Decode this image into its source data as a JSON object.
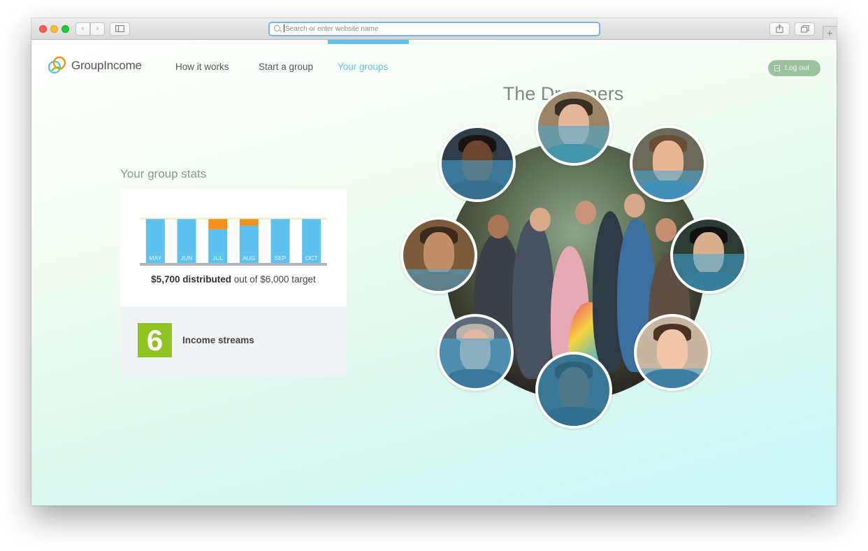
{
  "browser": {
    "address_placeholder": "Search or enter website name",
    "back_label": "‹",
    "forward_label": "›",
    "new_tab_label": "+"
  },
  "nav": {
    "logo_text": "GroupIncome",
    "items": [
      {
        "label": "How it works"
      },
      {
        "label": "Start a group"
      },
      {
        "label": "Your groups",
        "active": true
      }
    ],
    "logout_label": "Log out"
  },
  "group": {
    "name": "The Dreamers",
    "members": [
      {
        "id": "member-top"
      },
      {
        "id": "member-top-left"
      },
      {
        "id": "member-top-right"
      },
      {
        "id": "member-left"
      },
      {
        "id": "member-right"
      },
      {
        "id": "member-bottom-left"
      },
      {
        "id": "member-bottom-right"
      },
      {
        "id": "member-bottom"
      }
    ]
  },
  "stats": {
    "title": "Your group stats",
    "distributed_amount": "$5,700 distributed",
    "target_text": " out of $6,000 target",
    "income_streams_count": "6",
    "income_streams_label": "Income streams"
  },
  "chart_data": {
    "type": "bar",
    "categories": [
      "MAY",
      "JUN",
      "JUL",
      "AUG",
      "SEP",
      "OCT"
    ],
    "series": [
      {
        "values": [
          6000,
          6000,
          4600,
          5100,
          6000,
          6000
        ],
        "color": "#5ec2ee"
      },
      {
        "values": [
          0,
          0,
          1400,
          900,
          0,
          0
        ],
        "color": "#f5901e"
      }
    ],
    "target": 6000,
    "ylim": [
      0,
      6500
    ],
    "stacked": true,
    "grid": false
  },
  "colors": {
    "accent": "#5ec2ee",
    "shortfall": "#f5901e",
    "streams_badge": "#8fc31f",
    "logout": "#9bc39b"
  }
}
